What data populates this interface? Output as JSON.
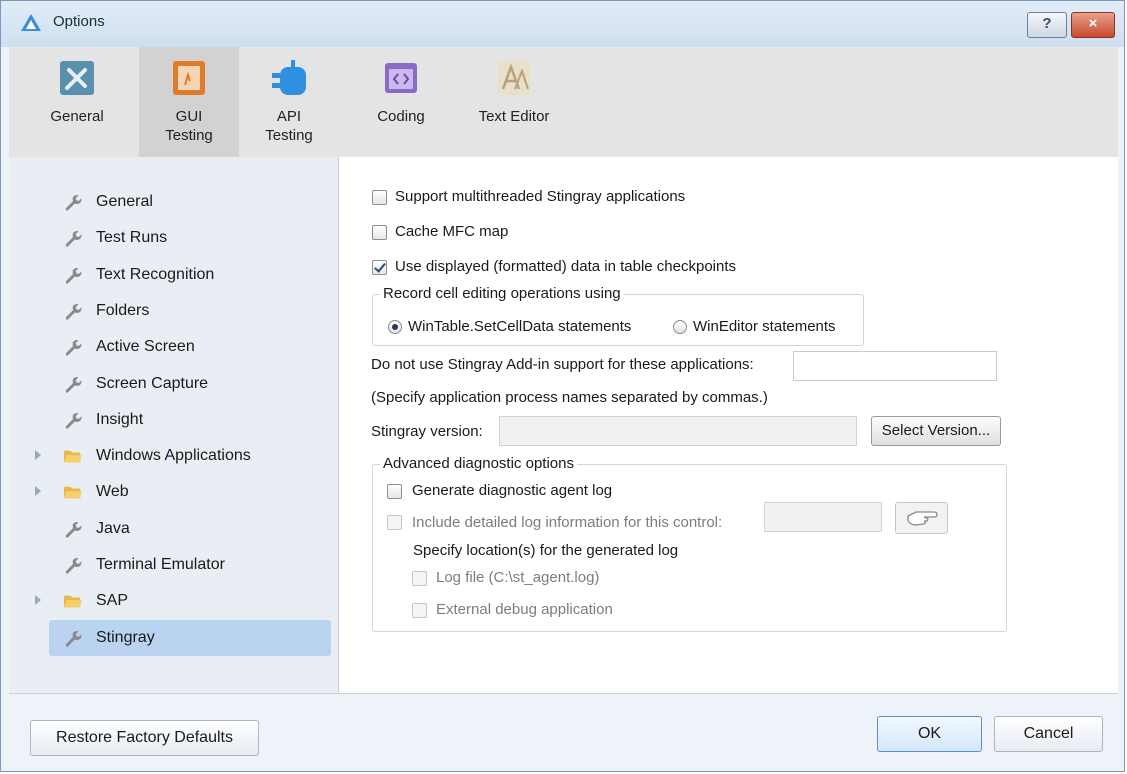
{
  "window": {
    "title": "Options",
    "help_label": "?",
    "close_label": "×"
  },
  "toolbar": {
    "items": [
      {
        "label": "General",
        "icon": "general-tools-icon",
        "color": "#5a8fae"
      },
      {
        "label": "GUI\nTesting",
        "icon": "gui-testing-icon",
        "color": "#e07b2a"
      },
      {
        "label": "API\nTesting",
        "icon": "api-testing-icon",
        "color": "#2f8fe0"
      },
      {
        "label": "Coding",
        "icon": "coding-icon",
        "color": "#8a6cc8"
      },
      {
        "label": "Text Editor",
        "icon": "text-editor-icon",
        "color": "#b8a27a"
      }
    ],
    "active_index": 1
  },
  "sidebar": {
    "items": [
      {
        "label": "General",
        "icon": "wrench-icon",
        "expandable": false
      },
      {
        "label": "Test Runs",
        "icon": "wrench-icon",
        "expandable": false
      },
      {
        "label": "Text Recognition",
        "icon": "wrench-icon",
        "expandable": false
      },
      {
        "label": "Folders",
        "icon": "wrench-icon",
        "expandable": false
      },
      {
        "label": "Active Screen",
        "icon": "wrench-icon",
        "expandable": false
      },
      {
        "label": "Screen Capture",
        "icon": "wrench-icon",
        "expandable": false
      },
      {
        "label": "Insight",
        "icon": "wrench-icon",
        "expandable": false
      },
      {
        "label": "Windows Applications",
        "icon": "folder-icon",
        "expandable": true
      },
      {
        "label": "Web",
        "icon": "folder-icon",
        "expandable": true
      },
      {
        "label": "Java",
        "icon": "wrench-icon",
        "expandable": false
      },
      {
        "label": "Terminal Emulator",
        "icon": "wrench-icon",
        "expandable": false
      },
      {
        "label": "SAP",
        "icon": "folder-icon",
        "expandable": true
      },
      {
        "label": "Stingray",
        "icon": "wrench-icon",
        "expandable": false
      }
    ],
    "selected_index": 12
  },
  "panel": {
    "multithreaded_label": "Support multithreaded Stingray applications",
    "multithreaded_checked": false,
    "cache_mfc_label": "Cache MFC map",
    "cache_mfc_checked": false,
    "use_displayed_label": "Use displayed (formatted) data in table checkpoints",
    "use_displayed_checked": true,
    "record_group_label": "Record cell editing operations using",
    "radio_setcelldata_label": "WinTable.SetCellData statements",
    "radio_wineditor_label": "WinEditor statements",
    "radio_selected": "WinTable.SetCellData statements",
    "do_not_use_label": "Do not use Stingray Add-in support for these applications:",
    "do_not_use_value": "",
    "specify_hint": "(Specify application process names separated by commas.)",
    "version_label": "Stingray version:",
    "version_value": "",
    "select_version_button": "Select Version...",
    "advanced_group_label": "Advanced diagnostic options",
    "generate_log_label": "Generate diagnostic agent log",
    "generate_log_checked": false,
    "include_detailed_label": "Include detailed log information for this control:",
    "include_detailed_value": "",
    "pointer_icon": "pointing-hand-icon",
    "specify_location_label": "Specify location(s) for the generated log",
    "log_file_label": "Log file (C:\\st_agent.log)",
    "external_debug_label": "External debug application"
  },
  "footer": {
    "restore_label": "Restore Factory Defaults",
    "ok_label": "OK",
    "cancel_label": "Cancel"
  }
}
